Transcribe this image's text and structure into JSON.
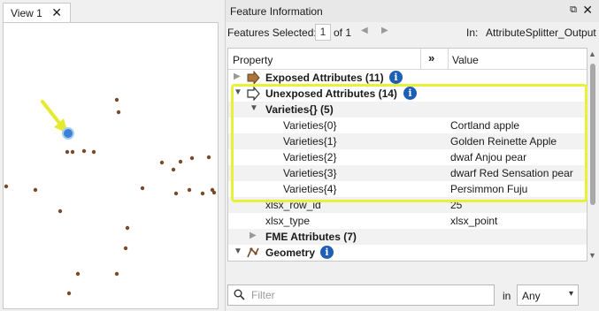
{
  "map_view": {
    "tab_label": "View 1",
    "close_glyph": "✕",
    "colors": {
      "point": "#7a4a2a",
      "selected": "#3b82d6",
      "arrow": "#e4ea2f"
    },
    "icons": [
      "close-icon",
      "arrow-annotation-icon"
    ]
  },
  "panel": {
    "title": "Feature Information",
    "float_glyph": "⧉",
    "close_glyph": "✕",
    "features_selected_label": "Features Selected:",
    "selected_value": "1",
    "of_label": "of 1",
    "prev_glyph": "◀",
    "next_glyph": "▶",
    "in_label": "In:",
    "dataset": "AttributeSplitter_Output"
  },
  "tree": {
    "header": {
      "property": "Property",
      "expand": "»",
      "value": "Value"
    },
    "info_glyph": "i",
    "rows": [
      {
        "label": "Exposed Attributes (11)",
        "value": "",
        "icon": "exposed-attributes-icon"
      },
      {
        "label": "Unexposed Attributes (14)",
        "value": "",
        "icon": "unexposed-attributes-icon"
      },
      {
        "label": "Varieties{} (5)",
        "value": ""
      },
      {
        "label": "Varieties{0}",
        "value": "Cortland apple"
      },
      {
        "label": "Varieties{1}",
        "value": "Golden Reinette Apple"
      },
      {
        "label": "Varieties{2}",
        "value": "dwaf Anjou pear"
      },
      {
        "label": "Varieties{3}",
        "value": "dwarf Red Sensation pear"
      },
      {
        "label": "Varieties{4}",
        "value": "Persimmon Fuju"
      },
      {
        "label": "xlsx_row_id",
        "value": "25"
      },
      {
        "label": "xlsx_type",
        "value": "xlsx_point"
      },
      {
        "label": "FME Attributes (7)",
        "value": ""
      },
      {
        "label": "Geometry",
        "value": "",
        "icon": "geometry-icon"
      }
    ],
    "highlight_color": "#e8f03a"
  },
  "filter": {
    "placeholder": "Filter",
    "value": "",
    "in_label": "in",
    "scope": "Any",
    "chevron": "▾"
  }
}
